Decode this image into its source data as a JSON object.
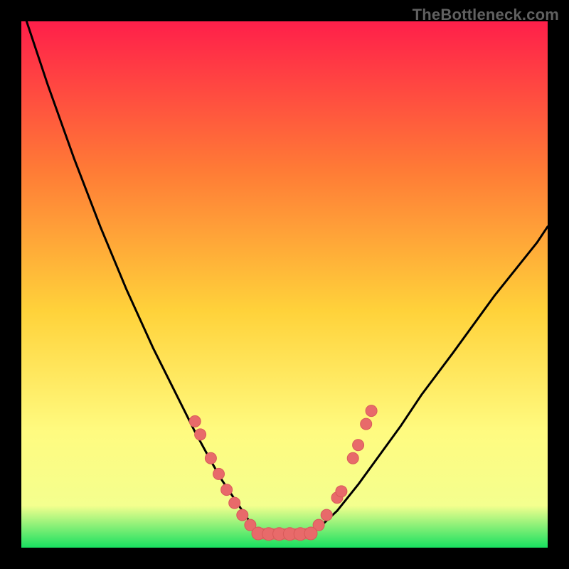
{
  "watermark": "TheBottleneck.com",
  "colors": {
    "gradient_top": "#ff1f4a",
    "gradient_q1": "#ff7a36",
    "gradient_mid": "#ffd23a",
    "gradient_q3": "#fffb80",
    "gradient_near_bottom": "#f4ff8e",
    "gradient_bottom": "#18e060",
    "curve": "#000000",
    "marker_fill": "#e86a6a",
    "marker_stroke": "#d85a5a"
  },
  "chart_data": {
    "type": "line",
    "title": "",
    "xlabel": "",
    "ylabel": "",
    "xlim": [
      0,
      100
    ],
    "ylim": [
      0,
      100
    ],
    "legend": false,
    "grid": false,
    "series": [
      {
        "name": "bottleneck-curve-left",
        "x": [
          0,
          5,
          10,
          15,
          20,
          25,
          30,
          33,
          36,
          38,
          40,
          42,
          44,
          45
        ],
        "values": [
          103,
          88,
          74,
          61,
          49,
          38,
          28,
          22,
          16.5,
          13,
          10,
          7,
          4,
          2.7
        ]
      },
      {
        "name": "bottleneck-curve-right",
        "x": [
          55,
          57,
          60,
          64,
          68,
          72,
          76,
          82,
          90,
          98,
          100
        ],
        "values": [
          2.7,
          4.2,
          7,
          12,
          17.5,
          23,
          29,
          37,
          48,
          58,
          61
        ]
      },
      {
        "name": "flat-minimum",
        "x": [
          45,
          47,
          50,
          53,
          55
        ],
        "values": [
          2.7,
          2.6,
          2.6,
          2.6,
          2.7
        ]
      }
    ],
    "markers": [
      {
        "group": "left-cluster",
        "points": [
          {
            "x": 33,
            "y": 24
          },
          {
            "x": 34,
            "y": 21.5
          },
          {
            "x": 36,
            "y": 17
          },
          {
            "x": 37.5,
            "y": 14
          },
          {
            "x": 39,
            "y": 11
          },
          {
            "x": 40.5,
            "y": 8.5
          },
          {
            "x": 42,
            "y": 6.2
          },
          {
            "x": 43.5,
            "y": 4.3
          }
        ]
      },
      {
        "group": "right-cluster",
        "points": [
          {
            "x": 56.5,
            "y": 4.3
          },
          {
            "x": 58,
            "y": 6.2
          },
          {
            "x": 60,
            "y": 9.5
          },
          {
            "x": 60.8,
            "y": 10.7
          },
          {
            "x": 63,
            "y": 17
          },
          {
            "x": 64,
            "y": 19.5
          },
          {
            "x": 65.5,
            "y": 23.5
          },
          {
            "x": 66.5,
            "y": 26
          }
        ]
      },
      {
        "group": "bottom-flat",
        "points": [
          {
            "x": 45,
            "y": 2.7
          },
          {
            "x": 47,
            "y": 2.6
          },
          {
            "x": 49,
            "y": 2.6
          },
          {
            "x": 51,
            "y": 2.6
          },
          {
            "x": 53,
            "y": 2.6
          },
          {
            "x": 55,
            "y": 2.7
          }
        ]
      }
    ]
  }
}
